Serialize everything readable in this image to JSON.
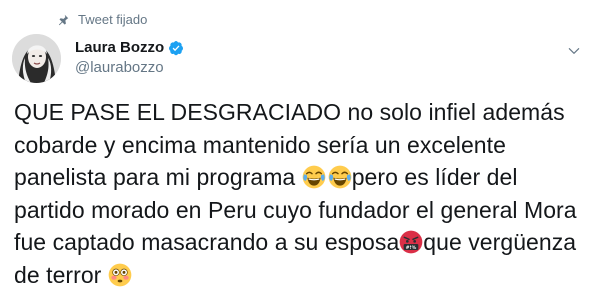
{
  "pinned": {
    "label": "Tweet fijado",
    "icon": "pin-icon"
  },
  "author": {
    "display_name": "Laura Bozzo",
    "handle": "@laurabozzo",
    "verified": true,
    "verified_icon": "verified-badge-icon",
    "avatar_icon": "avatar"
  },
  "menu": {
    "icon": "chevron-down-icon"
  },
  "tweet": {
    "segment_1": "QUE PASE EL DESGRACIADO no solo infiel además cobarde y encima mantenido sería un excelente panelista para mi programa ",
    "emoji_1": "face-with-tears-of-joy",
    "emoji_2": "face-with-tears-of-joy",
    "segment_2": "pero es líder del partido morado en Peru cuyo fundador el general Mora fue captado masacrando a su esposa",
    "emoji_3": "face-with-symbols-on-mouth",
    "segment_3": "que vergüenza de terror ",
    "emoji_4": "flushed-face"
  },
  "colors": {
    "text": "#14171a",
    "secondary": "#657786",
    "verified_blue": "#1da1f2",
    "background": "#ffffff"
  }
}
